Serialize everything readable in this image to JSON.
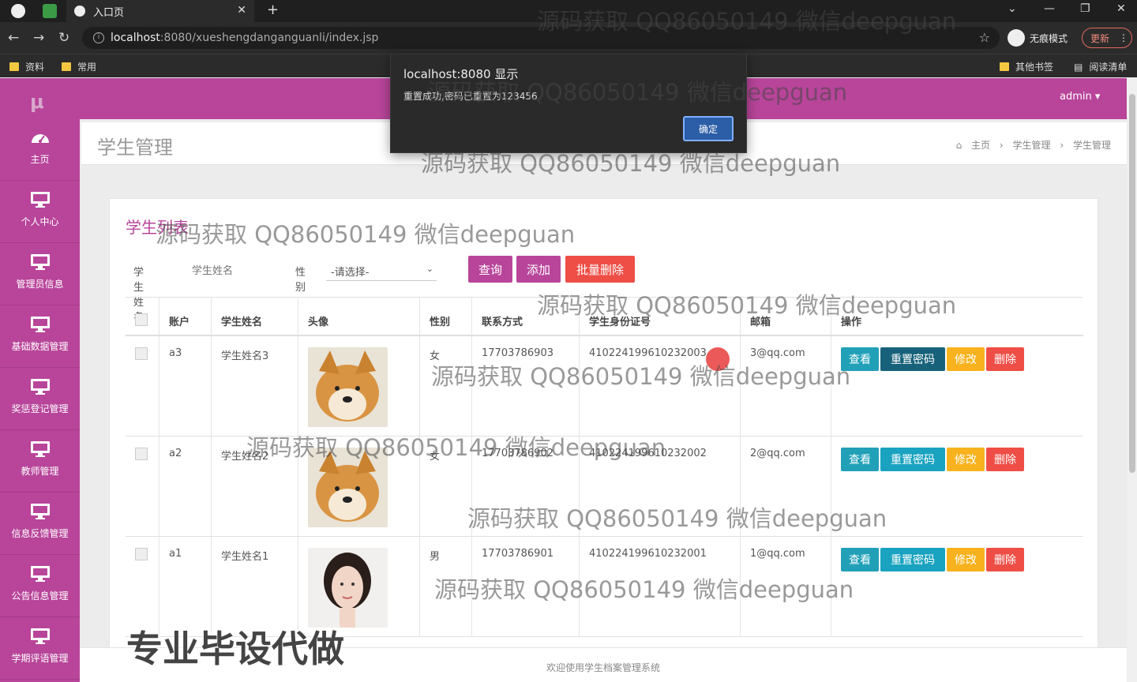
{
  "browser": {
    "tab_title": "入口页",
    "url_host": "localhost",
    "url_path": ":8080/xueshengdanganguanli/index.jsp",
    "incognito_label": "无痕模式",
    "update_label": "更新",
    "bookmarks": [
      "资料",
      "常用"
    ],
    "bookmarks_right": [
      "其他书签",
      "阅读清单"
    ]
  },
  "dialog": {
    "title": "localhost:8080 显示",
    "message": "重置成功,密码已重置为123456",
    "ok_label": "确定"
  },
  "header": {
    "logo": "μ",
    "user_menu": "admin ▾"
  },
  "sidebar": {
    "items": [
      {
        "label": "主页",
        "icon": "dashboard-icon"
      },
      {
        "label": "个人中心",
        "icon": "monitor-icon"
      },
      {
        "label": "管理员信息",
        "icon": "monitor-icon"
      },
      {
        "label": "基础数据管理",
        "icon": "monitor-icon"
      },
      {
        "label": "奖惩登记管理",
        "icon": "monitor-icon"
      },
      {
        "label": "教师管理",
        "icon": "monitor-icon"
      },
      {
        "label": "信息反馈管理",
        "icon": "monitor-icon"
      },
      {
        "label": "公告信息管理",
        "icon": "monitor-icon"
      },
      {
        "label": "学期评语管理",
        "icon": "monitor-icon"
      }
    ]
  },
  "page": {
    "title": "学生管理",
    "breadcrumb": [
      "主页",
      "学生管理",
      "学生管理"
    ],
    "card_title": "学生列表"
  },
  "filter": {
    "name_label": "学生姓名",
    "name_placeholder": "学生姓名",
    "gender_label": "性别",
    "gender_selected": "-请选择-",
    "search_label": "查询",
    "add_label": "添加",
    "batch_delete_label": "批量删除"
  },
  "table": {
    "columns": [
      "账户",
      "学生姓名",
      "头像",
      "性别",
      "联系方式",
      "学生身份证号",
      "邮箱",
      "操作"
    ],
    "rows": [
      {
        "account": "a3",
        "name": "学生姓名3",
        "avatar": "shiba-dog-photo",
        "gender": "女",
        "phone": "17703786903",
        "id_card": "410224199610232003",
        "email": "3@qq.com"
      },
      {
        "account": "a2",
        "name": "学生姓名2",
        "avatar": "shiba-dog-photo",
        "gender": "女",
        "phone": "17703786902",
        "id_card": "410224199610232002",
        "email": "2@qq.com"
      },
      {
        "account": "a1",
        "name": "学生姓名1",
        "avatar": "woman-portrait-photo",
        "gender": "男",
        "phone": "17703786901",
        "id_card": "410224199610232001",
        "email": "1@qq.com"
      }
    ],
    "actions": {
      "view": "查看",
      "reset": "重置密码",
      "edit": "修改",
      "delete": "删除"
    }
  },
  "footer": {
    "text": "欢迎使用学生档案管理系统"
  },
  "overlay": {
    "watermark": "源码获取 QQ86050149 微信deepguan",
    "promo": "专业毕设代做"
  },
  "colors": {
    "primary": "#b8459a",
    "danger": "#ee4e46",
    "info": "#21a0b8",
    "warning": "#f7b21d"
  }
}
